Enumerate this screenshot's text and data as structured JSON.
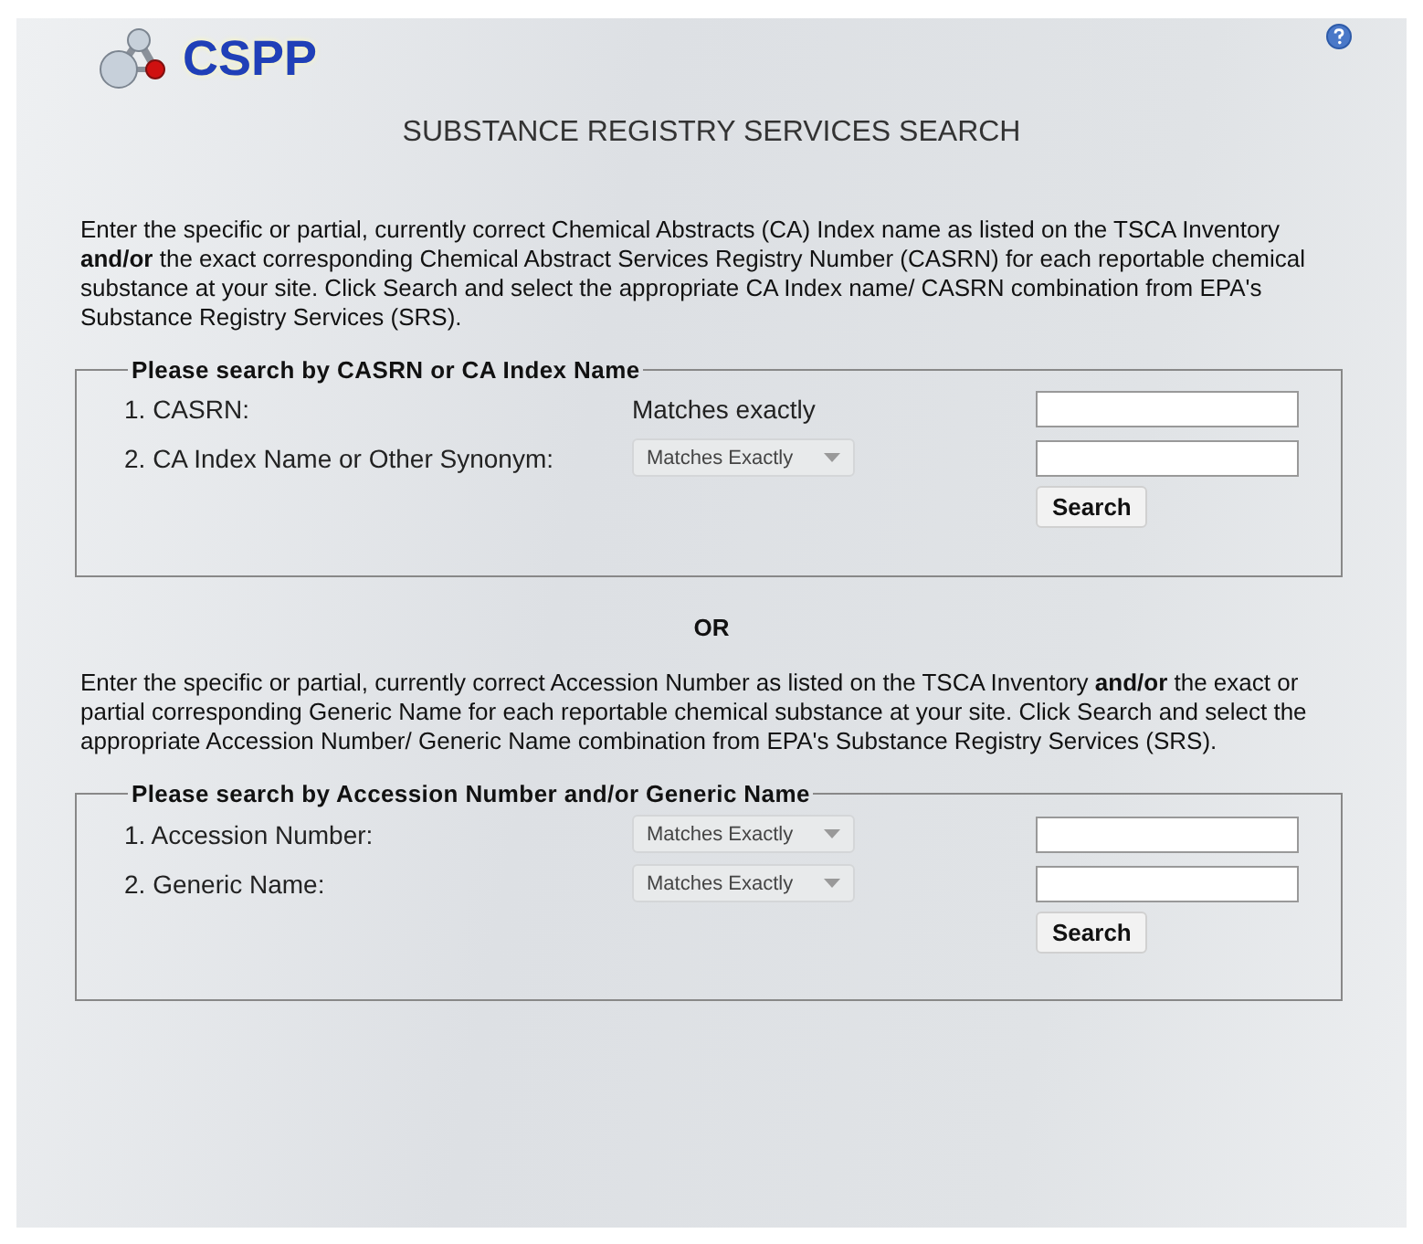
{
  "logo": {
    "text": "CSPP"
  },
  "title": "SUBSTANCE REGISTRY SERVICES SEARCH",
  "sections": [
    {
      "intro": "Enter the specific or partial, currently correct Chemical Abstracts (CA) Index name as listed on the TSCA Inventory **and/or** the exact corresponding Chemical Abstract Services Registry Number (CASRN) for each reportable chemical substance at your site. Click Search and select the appropriate CA Index name/ CASRN combination from EPA's Substance Registry Services (SRS).",
      "legend": "Please search by CASRN or CA Index Name",
      "rows": [
        {
          "label": "1. CASRN:",
          "matcher": {
            "kind": "text",
            "text": "Matches exactly"
          }
        },
        {
          "label": "2. CA Index Name or Other Synonym:",
          "matcher": {
            "kind": "dropdown",
            "text": "Matches Exactly"
          }
        }
      ],
      "button": "Search"
    },
    {
      "intro": "Enter the specific or partial, currently correct Accession Number as listed on the TSCA Inventory **and/or** the exact or partial corresponding Generic Name for each reportable chemical substance at your site. Click Search and select the appropriate Accession Number/ Generic Name combination from EPA's Substance Registry Services (SRS).",
      "legend": "Please search by Accession Number and/or Generic Name",
      "rows": [
        {
          "label": "1. Accession Number:",
          "matcher": {
            "kind": "dropdown",
            "text": "Matches Exactly"
          }
        },
        {
          "label": "2. Generic Name:",
          "matcher": {
            "kind": "dropdown",
            "text": "Matches Exactly"
          }
        }
      ],
      "button": "Search"
    }
  ],
  "separator": "OR"
}
